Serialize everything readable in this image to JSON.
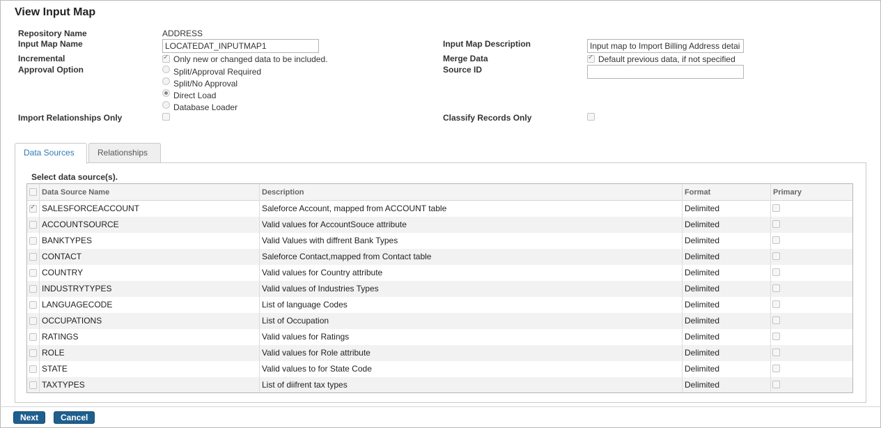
{
  "page": {
    "title": "View Input Map"
  },
  "form": {
    "repository_name_label": "Repository Name",
    "repository_name_value": "ADDRESS",
    "input_map_name_label": "Input Map Name",
    "input_map_name_value": "LOCATEDAT_INPUTMAP1",
    "incremental_label": "Incremental",
    "incremental_text": "Only new or changed data to be included.",
    "incremental_checked": true,
    "approval_option_label": "Approval Option",
    "approval_options": [
      {
        "label": "Split/Approval Required",
        "selected": false
      },
      {
        "label": "Split/No Approval",
        "selected": false
      },
      {
        "label": "Direct Load",
        "selected": true
      },
      {
        "label": "Database Loader",
        "selected": false
      }
    ],
    "import_relationships_label": "Import Relationships Only",
    "import_relationships_checked": false,
    "input_map_description_label": "Input Map Description",
    "input_map_description_value": "Input map to Import Billing Address detai",
    "merge_data_label": "Merge Data",
    "merge_data_text": "Default previous data, if not specified",
    "merge_data_checked": true,
    "source_id_label": "Source ID",
    "source_id_value": "",
    "classify_records_label": "Classify Records Only",
    "classify_records_checked": false
  },
  "tabs": [
    {
      "label": "Data Sources",
      "active": true
    },
    {
      "label": "Relationships",
      "active": false
    }
  ],
  "data_sources": {
    "caption": "Select data source(s).",
    "columns": [
      "Data Source Name",
      "Description",
      "Format",
      "Primary"
    ],
    "rows": [
      {
        "name": "SALESFORCEACCOUNT",
        "description": "Saleforce Account, mapped from ACCOUNT table",
        "format": "Delimited",
        "selected": true,
        "primary": false
      },
      {
        "name": "ACCOUNTSOURCE",
        "description": "Valid values for AccountSouce attribute",
        "format": "Delimited",
        "selected": false,
        "primary": false
      },
      {
        "name": "BANKTYPES",
        "description": "Valid Values with diffrent Bank Types",
        "format": "Delimited",
        "selected": false,
        "primary": false
      },
      {
        "name": "CONTACT",
        "description": "Saleforce Contact,mapped from Contact table",
        "format": "Delimited",
        "selected": false,
        "primary": false
      },
      {
        "name": "COUNTRY",
        "description": "Valid values for Country attribute",
        "format": "Delimited",
        "selected": false,
        "primary": false
      },
      {
        "name": "INDUSTRYTYPES",
        "description": "Valid values of Industries Types",
        "format": "Delimited",
        "selected": false,
        "primary": false
      },
      {
        "name": "LANGUAGECODE",
        "description": "List of language Codes",
        "format": "Delimited",
        "selected": false,
        "primary": false
      },
      {
        "name": "OCCUPATIONS",
        "description": "List of Occupation",
        "format": "Delimited",
        "selected": false,
        "primary": false
      },
      {
        "name": "RATINGS",
        "description": "Valid values for Ratings",
        "format": "Delimited",
        "selected": false,
        "primary": false
      },
      {
        "name": "ROLE",
        "description": "Valid values for Role attribute",
        "format": "Delimited",
        "selected": false,
        "primary": false
      },
      {
        "name": "STATE",
        "description": "Valid values to for State Code",
        "format": "Delimited",
        "selected": false,
        "primary": false
      },
      {
        "name": "TAXTYPES",
        "description": "List of diifrent tax types",
        "format": "Delimited",
        "selected": false,
        "primary": false
      }
    ]
  },
  "buttons": {
    "next": "Next",
    "cancel": "Cancel"
  }
}
